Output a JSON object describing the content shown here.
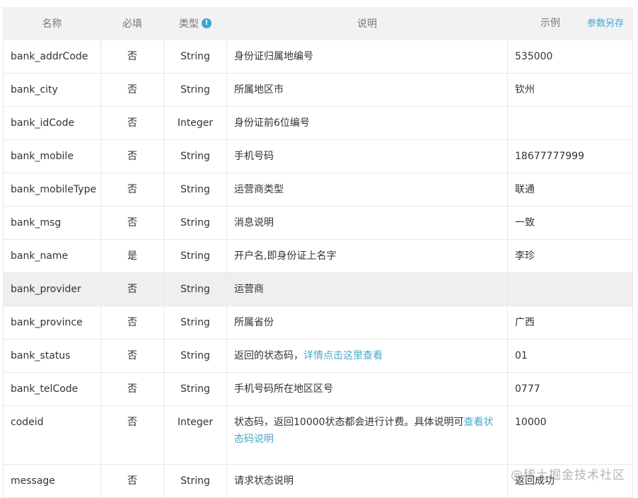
{
  "header": {
    "name": "名称",
    "required": "必填",
    "type": "类型",
    "info_glyph": "!",
    "description": "说明",
    "example": "示例",
    "save_as": "参数另存"
  },
  "rows": [
    {
      "name": "bank_addrCode",
      "required": "否",
      "type": "String",
      "desc": "身份证归属地编号",
      "example": "535000"
    },
    {
      "name": "bank_city",
      "required": "否",
      "type": "String",
      "desc": "所属地区市",
      "example": "钦州"
    },
    {
      "name": "bank_idCode",
      "required": "否",
      "type": "Integer",
      "desc": "身份证前6位编号",
      "example": ""
    },
    {
      "name": "bank_mobile",
      "required": "否",
      "type": "String",
      "desc": "手机号码",
      "example": "18677777999"
    },
    {
      "name": "bank_mobileType",
      "required": "否",
      "type": "String",
      "desc": "运营商类型",
      "example": "联通"
    },
    {
      "name": "bank_msg",
      "required": "否",
      "type": "String",
      "desc": "消息说明",
      "example": "一致"
    },
    {
      "name": "bank_name",
      "required": "是",
      "type": "String",
      "desc": "开户名,即身份证上名字",
      "example": "李珍"
    },
    {
      "name": "bank_provider",
      "required": "否",
      "type": "String",
      "desc": "运营商",
      "example": ""
    },
    {
      "name": "bank_province",
      "required": "否",
      "type": "String",
      "desc": "所属省份",
      "example": "广西"
    },
    {
      "name": "bank_status",
      "required": "否",
      "type": "String",
      "desc": "返回的状态码，",
      "desc_link": "详情点击这里查看",
      "example": "01"
    },
    {
      "name": "bank_telCode",
      "required": "否",
      "type": "String",
      "desc": "手机号码所在地区区号",
      "example": "0777"
    },
    {
      "name": "codeid",
      "required": "否",
      "type": "Integer",
      "desc": "状态码，返回10000状态都会进行计费。具体说明可",
      "desc_link": "查看状态码说明",
      "example": "10000"
    },
    {
      "name": "message",
      "required": "否",
      "type": "String",
      "desc": "请求状态说明",
      "example": "返回成功"
    }
  ],
  "watermark": "@稀土掘金技术社区"
}
